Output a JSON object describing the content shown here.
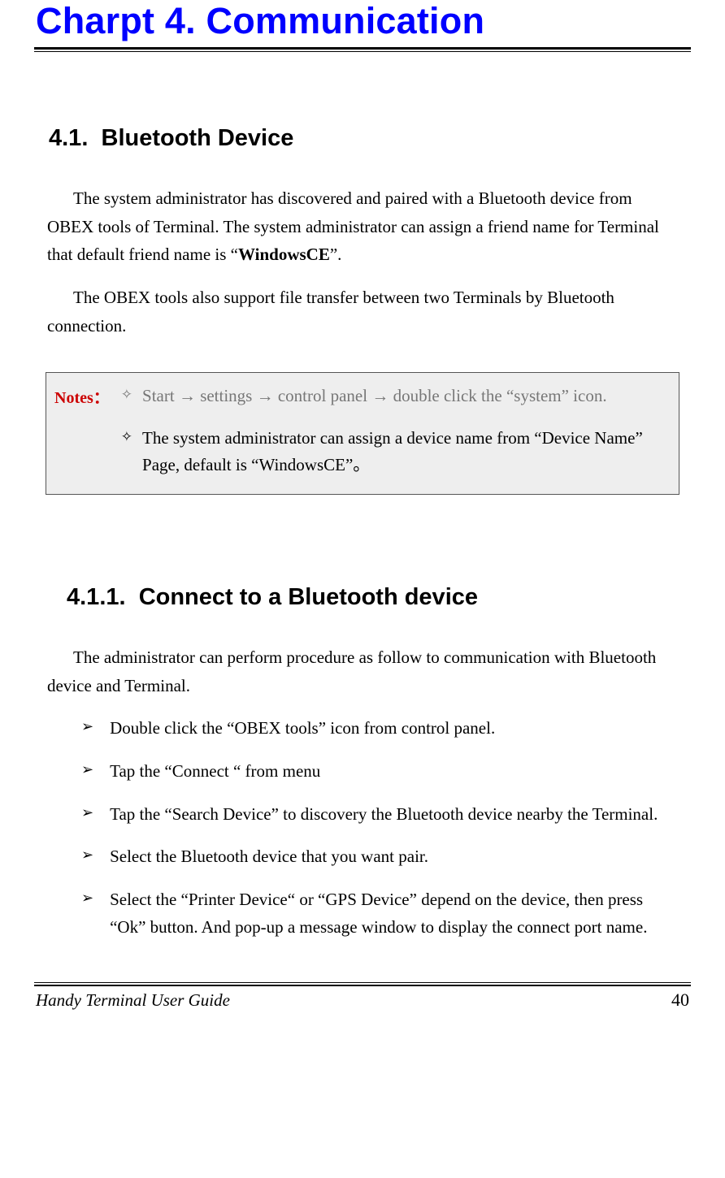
{
  "chapter_title": "Charpt 4.  Communication",
  "section": {
    "number": "4.1.",
    "title": "Bluetooth Device",
    "para1_pre": "The system administrator has discovered and paired with a Bluetooth device from OBEX tools of Terminal. The system administrator can assign a friend name for Terminal that default friend name is “",
    "para1_bold": "WindowsCE",
    "para1_post": "”.",
    "para2": "The OBEX tools also support file transfer between two Terminals by Bluetooth connection."
  },
  "notes": {
    "label": "Notes：",
    "item1_parts": [
      "Start ",
      "→",
      " settings ",
      "→",
      " control panel ",
      "→",
      " double click the “system” icon."
    ],
    "item2": "The system administrator can assign a device name from “Device Name” Page, default is “WindowsCE”。"
  },
  "subsection": {
    "number": "4.1.1.",
    "title": "Connect to a Bluetooth device",
    "para": "The administrator can perform procedure as follow to communication with Bluetooth device and Terminal.",
    "steps": [
      "Double click the “OBEX tools” icon from control panel.",
      "Tap the “Connect “ from menu",
      "Tap the “Search Device” to discovery the Bluetooth device nearby the Terminal.",
      "Select the Bluetooth device that you want pair.",
      "Select the “Printer Device“ or “GPS Device” depend on the device, then press “Ok” button. And pop-up a message window to display the connect port name."
    ]
  },
  "footer": {
    "doc_title": "Handy Terminal User Guide",
    "page": "40"
  },
  "bullets": {
    "diamond": "✧",
    "triangle": "➢"
  }
}
